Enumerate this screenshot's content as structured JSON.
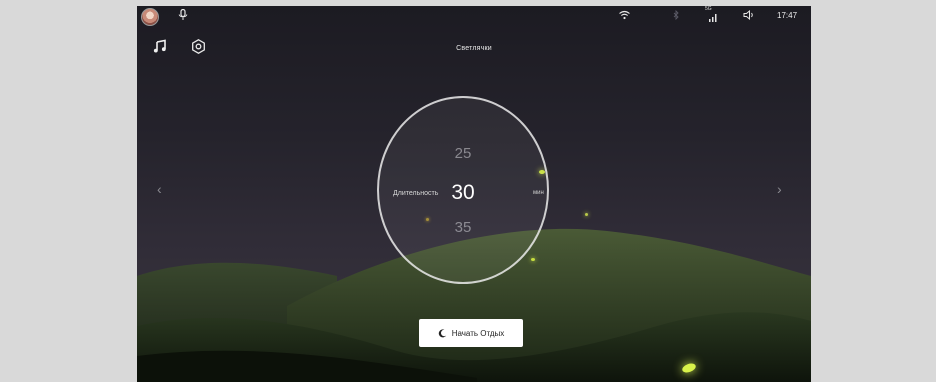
{
  "status": {
    "time": "17:47",
    "signal_label": "5G",
    "icons": [
      "avatar-icon",
      "mic-icon",
      "wifi-icon",
      "bluetooth-icon",
      "signal-icon",
      "volume-icon"
    ]
  },
  "header": {
    "title": "Светлячки",
    "icons": [
      "music-note-icon",
      "settings-icon"
    ]
  },
  "timer": {
    "label": "Длительность",
    "prev_value": "25",
    "value": "30",
    "next_value": "35",
    "unit": "мин"
  },
  "nav": {
    "prev_glyph": "‹",
    "next_glyph": "›"
  },
  "action": {
    "start_label": "Начать Отдых",
    "icon": "moon-icon"
  },
  "colors": {
    "sky_top": "#1c1b22",
    "sky_bottom": "#3a3640",
    "hill_dark": "#162012",
    "hill_light": "#2c3a22",
    "firefly": "#d8f24a"
  }
}
